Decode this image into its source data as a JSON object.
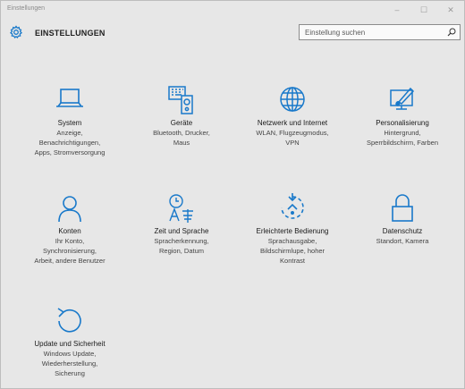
{
  "window": {
    "title": "Einstellungen",
    "controls": {
      "minimize": "–",
      "maximize": "☐",
      "close": "✕"
    }
  },
  "header": {
    "title": "EINSTELLUNGEN",
    "icon": "gear-icon"
  },
  "search": {
    "placeholder": "Einstellung suchen",
    "value": "",
    "icon": "search-icon"
  },
  "accent_color": "#1979ca",
  "tiles": [
    {
      "icon": "laptop-icon",
      "title": "System",
      "desc": [
        "Anzeige,",
        "Benachrichtigungen,",
        "Apps, Stromversorgung"
      ]
    },
    {
      "icon": "devices-icon",
      "title": "Geräte",
      "desc": [
        "Bluetooth, Drucker,",
        "Maus"
      ]
    },
    {
      "icon": "globe-icon",
      "title": "Netzwerk und Internet",
      "desc": [
        "WLAN, Flugzeugmodus,",
        "VPN"
      ]
    },
    {
      "icon": "personalization-icon",
      "title": "Personalisierung",
      "desc": [
        "Hintergrund,",
        "Sperrbildschirm, Farben"
      ]
    },
    {
      "icon": "person-icon",
      "title": "Konten",
      "desc": [
        "Ihr Konto,",
        "Synchronisierung,",
        "Arbeit, andere Benutzer"
      ]
    },
    {
      "icon": "time-language-icon",
      "title": "Zeit und Sprache",
      "desc": [
        "Spracherkennung,",
        "Region, Datum"
      ]
    },
    {
      "icon": "ease-of-access-icon",
      "title": "Erleichterte Bedienung",
      "desc": [
        "Sprachausgabe,",
        "Bildschirmlupe, hoher",
        "Kontrast"
      ]
    },
    {
      "icon": "lock-icon",
      "title": "Datenschutz",
      "desc": [
        "Standort, Kamera"
      ]
    },
    {
      "icon": "update-icon",
      "title": "Update und Sicherheit",
      "desc": [
        "Windows Update,",
        "Wiederherstellung,",
        "Sicherung"
      ]
    }
  ]
}
